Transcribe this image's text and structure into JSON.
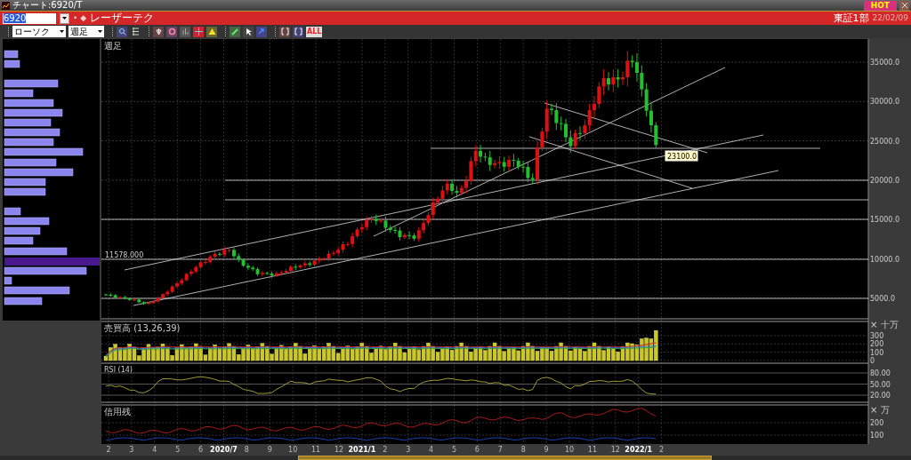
{
  "window": {
    "title": "チャート:6920/T",
    "badge": "HOT"
  },
  "symbol_bar": {
    "code": "6920",
    "marks": "• ◆",
    "name": "レーザーテク",
    "market": "東証1部",
    "date": "22/02/09"
  },
  "toolbar": {
    "chart_type": "ローソク",
    "period": "週足",
    "all_button": "ALL"
  },
  "price_panel": {
    "label": "週足",
    "yticks": [
      "35000.0",
      "30000.0",
      "25000.0",
      "20000.0",
      "15000.0",
      "10000.0",
      "5000.0"
    ],
    "line_label": "11578.000",
    "last_price": "23100.0"
  },
  "volume_panel": {
    "label": "売買高 (13,26,39)",
    "unit": "× 十万",
    "yticks": [
      "300",
      "200",
      "100",
      "0"
    ]
  },
  "rsi_panel": {
    "label": "RSI (14)",
    "yticks": [
      "80.00",
      "50.00",
      "20.00"
    ]
  },
  "credit_panel": {
    "label": "信用残",
    "unit": "× 万",
    "yticks": [
      "200",
      "100"
    ]
  },
  "xaxis": [
    {
      "label": "2",
      "major": false
    },
    {
      "label": "3",
      "major": false
    },
    {
      "label": "4",
      "major": false
    },
    {
      "label": "5",
      "major": false
    },
    {
      "label": "6",
      "major": false
    },
    {
      "label": "2020/7",
      "major": true
    },
    {
      "label": "8",
      "major": false
    },
    {
      "label": "9",
      "major": false
    },
    {
      "label": "10",
      "major": false
    },
    {
      "label": "11",
      "major": false
    },
    {
      "label": "12",
      "major": false
    },
    {
      "label": "2021/1",
      "major": true
    },
    {
      "label": "2",
      "major": false
    },
    {
      "label": "3",
      "major": false
    },
    {
      "label": "4",
      "major": false
    },
    {
      "label": "5",
      "major": false
    },
    {
      "label": "6",
      "major": false
    },
    {
      "label": "7",
      "major": false
    },
    {
      "label": "8",
      "major": false
    },
    {
      "label": "9",
      "major": false
    },
    {
      "label": "10",
      "major": false
    },
    {
      "label": "11",
      "major": false
    },
    {
      "label": "12",
      "major": false
    },
    {
      "label": "2022/1",
      "major": true
    },
    {
      "label": "2",
      "major": false
    }
  ]
}
